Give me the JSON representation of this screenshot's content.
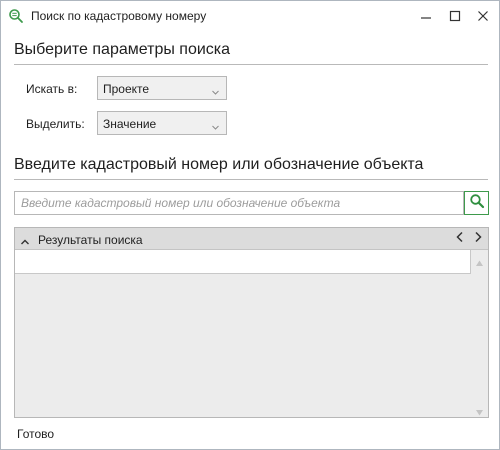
{
  "window": {
    "title": "Поиск по кадастровому номеру",
    "icon": "magnifier-icon"
  },
  "params": {
    "heading": "Выберите параметры поиска",
    "search_in_label": "Искать в:",
    "search_in_value": "Проекте",
    "highlight_label": "Выделить:",
    "highlight_value": "Значение"
  },
  "search": {
    "heading": "Введите кадастровый номер или обозначение объекта",
    "placeholder": "Введите кадастровый номер или обозначение объекта",
    "value": "",
    "button_icon": "search-icon"
  },
  "results": {
    "title": "Результаты поиска",
    "rows": []
  },
  "status": {
    "text": "Готово"
  },
  "colors": {
    "accent": "#3e9a4c",
    "panel_bg": "#ececec",
    "header_bg": "#dcdcdc",
    "border": "#b7b7b7"
  }
}
